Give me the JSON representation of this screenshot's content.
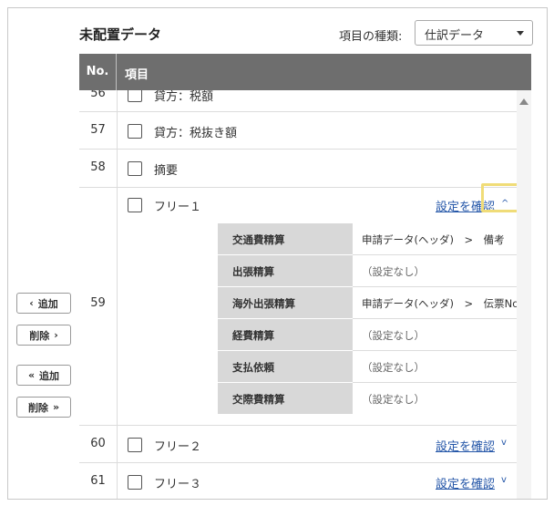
{
  "header": {
    "title": "未配置データ",
    "kind_label": "項目の種類:",
    "kind_value": "仕訳データ"
  },
  "side_buttons": [
    {
      "icon": "‹",
      "label": "追加"
    },
    {
      "label": "削除",
      "icon": "›"
    },
    {
      "icon": "«",
      "label": "追加"
    },
    {
      "label": "削除",
      "icon": "»"
    }
  ],
  "table": {
    "col_no": "No.",
    "col_item": "項目",
    "rows": [
      {
        "no": "56",
        "label": "貸方：税額"
      },
      {
        "no": "57",
        "label": "貸方：税抜き額"
      },
      {
        "no": "58",
        "label": "摘要"
      },
      {
        "no": "59",
        "label": "フリー１",
        "link": "設定を確認",
        "expanded": true
      },
      {
        "no": "60",
        "label": "フリー２",
        "link": "設定を確認",
        "expanded": false
      },
      {
        "no": "61",
        "label": "フリー３",
        "link": "設定を確認",
        "expanded": false
      }
    ],
    "settings": [
      {
        "name": "交通費精算",
        "value": "申請データ(ヘッダ)　>　備考"
      },
      {
        "name": "出張精算",
        "value": "（設定なし）"
      },
      {
        "name": "海外出張精算",
        "value": "申請データ(ヘッダ)　>　伝票No."
      },
      {
        "name": "経費精算",
        "value": "（設定なし）"
      },
      {
        "name": "支払依頼",
        "value": "（設定なし）"
      },
      {
        "name": "交際費精算",
        "value": "（設定なし）"
      }
    ]
  },
  "colors": {
    "header_bg": "#6e6e6e",
    "link": "#2456a8",
    "highlight": "#f0dc78",
    "subkey_bg": "#d8d8d8"
  }
}
